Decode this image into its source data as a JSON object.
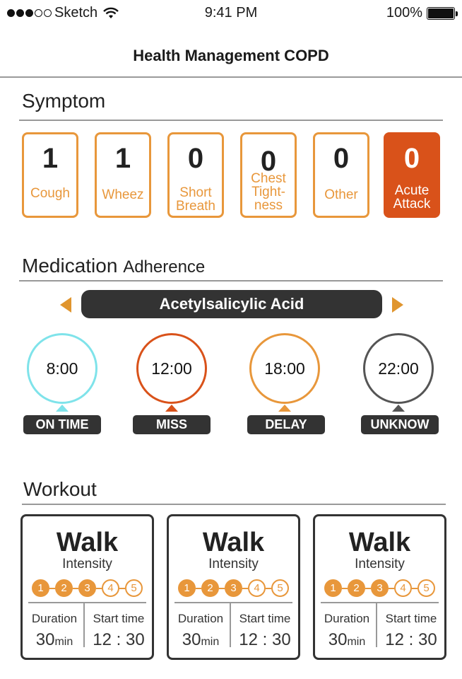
{
  "status": {
    "carrier": "Sketch",
    "time": "9:41 PM",
    "battery": "100%"
  },
  "nav": {
    "title": "Health Management  COPD"
  },
  "symptom": {
    "title": "Symptom",
    "items": [
      {
        "count": "1",
        "label": "Cough"
      },
      {
        "count": "1",
        "label": "Wheez"
      },
      {
        "count": "0",
        "label": "Short Breath"
      },
      {
        "count": "0",
        "label": "Chest Tight-ness"
      },
      {
        "count": "0",
        "label": "Other"
      },
      {
        "count": "0",
        "label": "Acute Attack"
      }
    ]
  },
  "medication": {
    "title_main": "Medication",
    "title_sub": "Adherence",
    "drug": "Acetylsalicylic Acid",
    "doses": [
      {
        "time": "8:00",
        "status": "ON TIME",
        "color": "#7fe3ea"
      },
      {
        "time": "12:00",
        "status": "MISS",
        "color": "#d9521a"
      },
      {
        "time": "18:00",
        "status": "DELAY",
        "color": "#e8973b"
      },
      {
        "time": "22:00",
        "status": "UNKNOW",
        "color": "#555555"
      }
    ]
  },
  "workout": {
    "title": "Workout",
    "cards": [
      {
        "activity": "Walk",
        "intensity_label": "Intensity",
        "level": 3,
        "duration_label": "Duration",
        "duration": "30",
        "duration_unit": "min",
        "start_label": "Start time",
        "start": "12 : 30"
      },
      {
        "activity": "Walk",
        "intensity_label": "Intensity",
        "level": 3,
        "duration_label": "Duration",
        "duration": "30",
        "duration_unit": "min",
        "start_label": "Start time",
        "start": "12 : 30"
      },
      {
        "activity": "Walk",
        "intensity_label": "Intensity",
        "level": 3,
        "duration_label": "Duration",
        "duration": "30",
        "duration_unit": "min",
        "start_label": "Start time",
        "start": "12 : 30"
      }
    ],
    "level_numbers": [
      "1",
      "2",
      "3",
      "4",
      "5"
    ]
  },
  "colors": {
    "accent": "#e8973b",
    "alert": "#d9521a",
    "dark": "#333333"
  }
}
